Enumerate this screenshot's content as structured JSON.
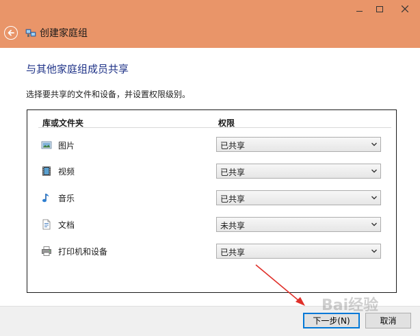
{
  "window": {
    "title": "创建家庭组",
    "title_bar_color": "#e99569"
  },
  "page": {
    "heading": "与其他家庭组成员共享",
    "description": "选择要共享的文件和设备，并设置权限级别。"
  },
  "table": {
    "columns": [
      "库或文件夹",
      "权限"
    ],
    "rows": [
      {
        "icon": "pictures-icon",
        "label": "图片",
        "permission": "已共享"
      },
      {
        "icon": "videos-icon",
        "label": "视频",
        "permission": "已共享"
      },
      {
        "icon": "music-icon",
        "label": "音乐",
        "permission": "已共享"
      },
      {
        "icon": "documents-icon",
        "label": "文档",
        "permission": "未共享"
      },
      {
        "icon": "printer-icon",
        "label": "打印机和设备",
        "permission": "已共享"
      }
    ]
  },
  "footer": {
    "next_label": "下一步(N)",
    "cancel_label": "取消"
  },
  "watermark": "Bai经验"
}
